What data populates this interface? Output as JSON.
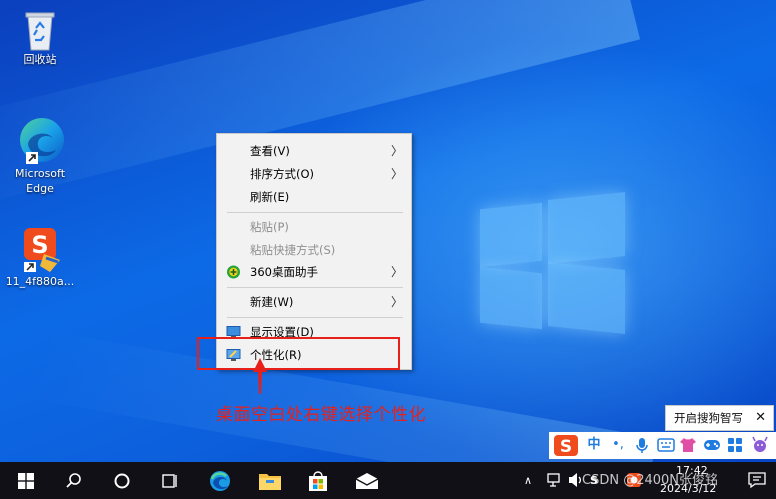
{
  "desktop": {
    "icons": [
      {
        "label": "回收站",
        "icon": "recycle-bin-icon"
      },
      {
        "label": "Microsoft Edge",
        "line1": "Microsoft",
        "line2": "Edge",
        "icon": "edge-icon"
      },
      {
        "label": "11_4f880a...",
        "icon": "sogou-installer-icon"
      }
    ]
  },
  "context_menu": {
    "items": [
      {
        "label": "查看(V)",
        "submenu": true,
        "enabled": true
      },
      {
        "label": "排序方式(O)",
        "submenu": true,
        "enabled": true
      },
      {
        "label": "刷新(E)",
        "enabled": true
      },
      {
        "label": "粘贴(P)",
        "enabled": false
      },
      {
        "label": "粘贴快捷方式(S)",
        "enabled": false
      },
      {
        "label": "360桌面助手",
        "submenu": true,
        "enabled": true,
        "icon": "360-icon"
      },
      {
        "label": "新建(W)",
        "submenu": true,
        "enabled": true
      },
      {
        "label": "显示设置(D)",
        "enabled": true,
        "icon": "display-settings-icon"
      },
      {
        "label": "个性化(R)",
        "enabled": true,
        "icon": "personalize-icon"
      }
    ],
    "arrow_glyph": "〉"
  },
  "annotation": {
    "caption": "桌面空白处右键选择个性化",
    "color": "#e8201a"
  },
  "sogou": {
    "tip_label": "开启搜狗智写",
    "close_glyph": "✕",
    "mode_label": "中",
    "punct_label": "•,"
  },
  "taskbar": {
    "clock_time": "17:42",
    "clock_date": "2024/3/12",
    "tray_chevron": "∧",
    "input_label": "S",
    "watermark": "CSDN @2400N张俊铭"
  },
  "colors": {
    "accent": "#0d6ae6",
    "taskbar": "#101016",
    "menu_bg": "#f2f2f2",
    "highlight": "#e8201a"
  }
}
